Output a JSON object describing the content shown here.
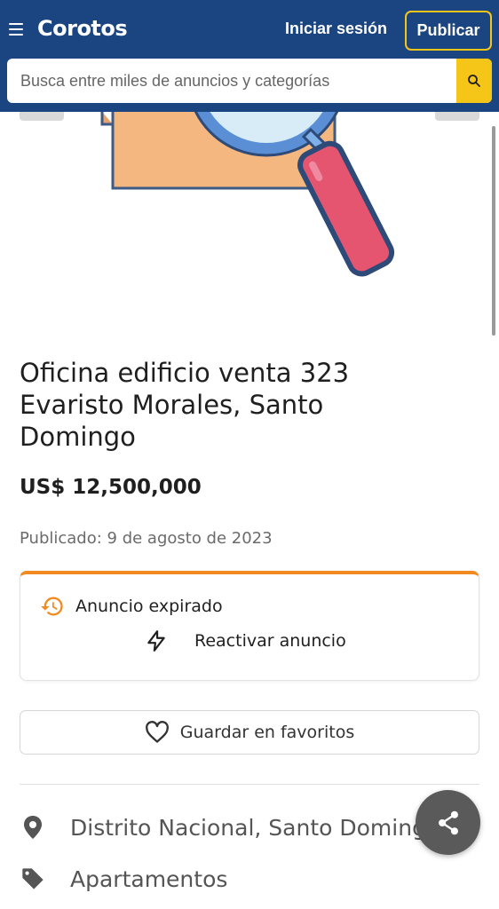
{
  "header": {
    "brand": "Corotos",
    "menu_icon": "hamburger-menu-icon",
    "login_label": "Iniciar sesión",
    "publish_label": "Publicar",
    "accent_color": "#f5c518",
    "bg_color": "#1b4581"
  },
  "search": {
    "placeholder": "Busca entre miles de anuncios y categorías",
    "icon": "search-icon"
  },
  "listing": {
    "image_icon": "magnifying-glass-box-illustration",
    "title": "Oficina edificio venta 323 Evaristo Morales, Santo Domingo",
    "price": "US$ 12,500,000",
    "published": "Publicado: 9 de agosto de 2023"
  },
  "status_card": {
    "status_label": "Anuncio expirado",
    "status_icon": "history-icon",
    "reactivate_label": "Reactivar anuncio",
    "reactivate_icon": "lightning-icon",
    "accent_color": "#f18a21"
  },
  "favorite": {
    "label": "Guardar en favoritos",
    "icon": "heart-icon"
  },
  "details": {
    "location": "Distrito Nacional, Santo Domingo",
    "location_icon": "map-pin-icon",
    "category": "Apartamentos",
    "category_icon": "tag-icon"
  },
  "share": {
    "icon": "share-icon"
  }
}
